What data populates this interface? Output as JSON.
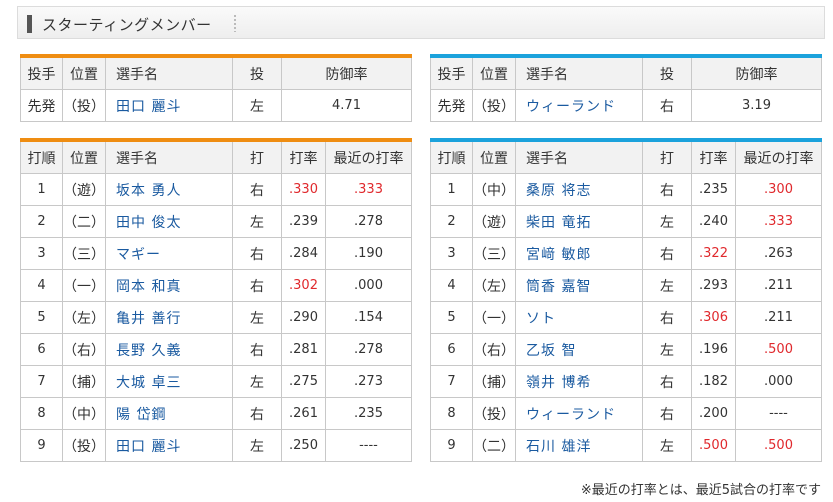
{
  "header": {
    "title": "スターティングメンバー"
  },
  "pitcher_headers": [
    "投手",
    "位置",
    "選手名",
    "投",
    "防御率"
  ],
  "lineup_headers": [
    "打順",
    "位置",
    "選手名",
    "打",
    "打率",
    "最近の打率"
  ],
  "home": {
    "pitcher": {
      "role": "先発",
      "pos": "（投）",
      "name": "田口 麗斗",
      "hand": "左",
      "era": "4.71"
    },
    "lineup": [
      {
        "order": "1",
        "pos": "（遊）",
        "name": "坂本 勇人",
        "hand": "右",
        "avg": ".330",
        "recent": ".333",
        "avg_red": true,
        "recent_red": true
      },
      {
        "order": "2",
        "pos": "（二）",
        "name": "田中 俊太",
        "hand": "左",
        "avg": ".239",
        "recent": ".278",
        "avg_red": false,
        "recent_red": false
      },
      {
        "order": "3",
        "pos": "（三）",
        "name": "マギー",
        "hand": "右",
        "avg": ".284",
        "recent": ".190",
        "avg_red": false,
        "recent_red": false
      },
      {
        "order": "4",
        "pos": "（一）",
        "name": "岡本 和真",
        "hand": "右",
        "avg": ".302",
        "recent": ".000",
        "avg_red": true,
        "recent_red": false
      },
      {
        "order": "5",
        "pos": "（左）",
        "name": "亀井 善行",
        "hand": "左",
        "avg": ".290",
        "recent": ".154",
        "avg_red": false,
        "recent_red": false
      },
      {
        "order": "6",
        "pos": "（右）",
        "name": "長野 久義",
        "hand": "右",
        "avg": ".281",
        "recent": ".278",
        "avg_red": false,
        "recent_red": false
      },
      {
        "order": "7",
        "pos": "（捕）",
        "name": "大城 卓三",
        "hand": "左",
        "avg": ".275",
        "recent": ".273",
        "avg_red": false,
        "recent_red": false
      },
      {
        "order": "8",
        "pos": "（中）",
        "name": "陽 岱鋼",
        "hand": "右",
        "avg": ".261",
        "recent": ".235",
        "avg_red": false,
        "recent_red": false
      },
      {
        "order": "9",
        "pos": "（投）",
        "name": "田口 麗斗",
        "hand": "左",
        "avg": ".250",
        "recent": "----",
        "avg_red": false,
        "recent_red": false
      }
    ]
  },
  "away": {
    "pitcher": {
      "role": "先発",
      "pos": "（投）",
      "name": "ウィーランド",
      "hand": "右",
      "era": "3.19"
    },
    "lineup": [
      {
        "order": "1",
        "pos": "（中）",
        "name": "桑原 将志",
        "hand": "右",
        "avg": ".235",
        "recent": ".300",
        "avg_red": false,
        "recent_red": true
      },
      {
        "order": "2",
        "pos": "（遊）",
        "name": "柴田 竜拓",
        "hand": "左",
        "avg": ".240",
        "recent": ".333",
        "avg_red": false,
        "recent_red": true
      },
      {
        "order": "3",
        "pos": "（三）",
        "name": "宮﨑 敏郎",
        "hand": "右",
        "avg": ".322",
        "recent": ".263",
        "avg_red": true,
        "recent_red": false
      },
      {
        "order": "4",
        "pos": "（左）",
        "name": "筒香 嘉智",
        "hand": "左",
        "avg": ".293",
        "recent": ".211",
        "avg_red": false,
        "recent_red": false
      },
      {
        "order": "5",
        "pos": "（一）",
        "name": "ソト",
        "hand": "右",
        "avg": ".306",
        "recent": ".211",
        "avg_red": true,
        "recent_red": false
      },
      {
        "order": "6",
        "pos": "（右）",
        "name": "乙坂 智",
        "hand": "左",
        "avg": ".196",
        "recent": ".500",
        "avg_red": false,
        "recent_red": true
      },
      {
        "order": "7",
        "pos": "（捕）",
        "name": "嶺井 博希",
        "hand": "右",
        "avg": ".182",
        "recent": ".000",
        "avg_red": false,
        "recent_red": false
      },
      {
        "order": "8",
        "pos": "（投）",
        "name": "ウィーランド",
        "hand": "右",
        "avg": ".200",
        "recent": "----",
        "avg_red": false,
        "recent_red": false
      },
      {
        "order": "9",
        "pos": "（二）",
        "name": "石川 雄洋",
        "hand": "左",
        "avg": ".500",
        "recent": ".500",
        "avg_red": true,
        "recent_red": true
      }
    ]
  },
  "colors": {
    "home_accent": "#ef8d12",
    "away_accent": "#1ba2dc",
    "highlight": "#e0292d",
    "link": "#1a5aa0"
  },
  "footnote": "※最近の打率とは、最近5試合の打率です"
}
